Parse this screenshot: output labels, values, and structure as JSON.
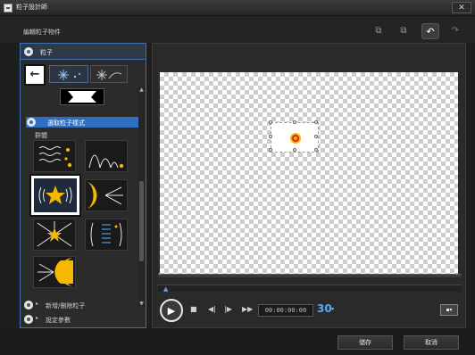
{
  "window": {
    "title": "粒子設計師",
    "close": "✕"
  },
  "toolbar": {
    "breadcrumb": "編輯粒子物件",
    "copy_icon": "⧉",
    "paste_icon": "⧉",
    "undo_icon": "↶",
    "redo_icon": "↷"
  },
  "panel": {
    "header": "粒子",
    "back_icon": "←",
    "section_title": "選取粒子樣式",
    "sub_label": "群體",
    "scroll_up": "▲",
    "scroll_down": "▼",
    "rows": [
      {
        "label": "新增/刪除粒子"
      },
      {
        "label": "設定參數"
      }
    ],
    "row_arrow": "▸"
  },
  "colors": {
    "accent": "#2f6fc2",
    "star": "#f5b800",
    "emitter_center": "#e02020"
  },
  "preview": {
    "timecode": "00:00:00:00",
    "fps": "30",
    "fps_arrow": "▾",
    "play_icon": "▶",
    "stop_icon": "■",
    "prev_icon": "◀|",
    "next_icon": "|▶",
    "end_icon": "▶▶",
    "view_icon": "▪▾",
    "track_left": "◂",
    "track_right": "▸",
    "marker": "▲"
  },
  "footer": {
    "save": "儲存",
    "cancel": "取消"
  }
}
